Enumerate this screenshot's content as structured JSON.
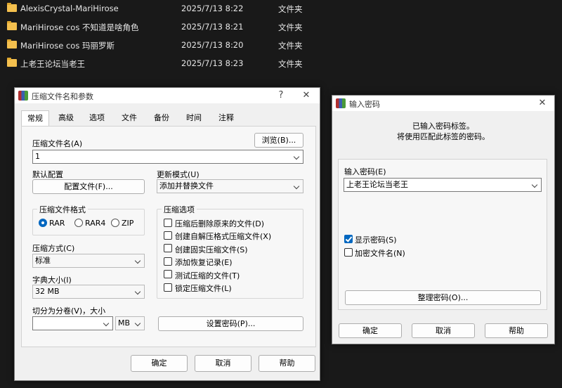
{
  "explorer": {
    "rows": [
      {
        "name": "AlexisCrystal-MariHirose",
        "date": "2025/7/13 8:22",
        "type": "文件夹"
      },
      {
        "name": "MariHirose cos 不知道是啥角色",
        "date": "2025/7/13 8:21",
        "type": "文件夹"
      },
      {
        "name": "MariHirose cos 玛丽罗斯",
        "date": "2025/7/13 8:20",
        "type": "文件夹"
      },
      {
        "name": "上老王论坛当老王",
        "date": "2025/7/13 8:23",
        "type": "文件夹"
      }
    ]
  },
  "archive_dialog": {
    "title": "压缩文件名和参数",
    "help_glyph": "?",
    "close_glyph": "✕",
    "tabs": [
      "常规",
      "高级",
      "选项",
      "文件",
      "备份",
      "时间",
      "注释"
    ],
    "archive_name_label": "压缩文件名(A)",
    "browse_button": "浏览(B)...",
    "archive_name_value": "1",
    "default_profile_label": "默认配置",
    "profile_button": "配置文件(F)...",
    "update_mode_label": "更新模式(U)",
    "update_mode_value": "添加并替换文件",
    "format_group_title": "压缩文件格式",
    "formats": [
      {
        "label": "RAR",
        "selected": true
      },
      {
        "label": "RAR4",
        "selected": false
      },
      {
        "label": "ZIP",
        "selected": false
      }
    ],
    "options_group_title": "压缩选项",
    "options": [
      {
        "label": "压缩后删除原来的文件(D)",
        "checked": false
      },
      {
        "label": "创建自解压格式压缩文件(X)",
        "checked": false
      },
      {
        "label": "创建固实压缩文件(S)",
        "checked": false
      },
      {
        "label": "添加恢复记录(E)",
        "checked": false
      },
      {
        "label": "测试压缩的文件(T)",
        "checked": false
      },
      {
        "label": "锁定压缩文件(L)",
        "checked": false
      }
    ],
    "method_label": "压缩方式(C)",
    "method_value": "标准",
    "dict_label": "字典大小(I)",
    "dict_value": "32 MB",
    "split_label": "切分为分卷(V)，大小",
    "split_value": "",
    "split_unit": "MB",
    "set_password_button": "设置密码(P)...",
    "ok_button": "确定",
    "cancel_button": "取消",
    "help_button": "帮助"
  },
  "password_dialog": {
    "title": "输入密码",
    "close_glyph": "✕",
    "info_line1": "已输入密码标签。",
    "info_line2": "将使用匹配此标签的密码。",
    "password_label": "输入密码(E)",
    "password_value": "上老王论坛当老王",
    "show_password": {
      "label": "显示密码(S)",
      "checked": true
    },
    "encrypt_names": {
      "label": "加密文件名(N)",
      "checked": false
    },
    "organize_button": "整理密码(O)...",
    "ok_button": "确定",
    "cancel_button": "取消",
    "help_button": "帮助"
  },
  "colors": {
    "desktop": "#191919",
    "dialog_bg": "#f0f0f0",
    "accent": "#0067c0",
    "folder": "#f4c04e"
  }
}
